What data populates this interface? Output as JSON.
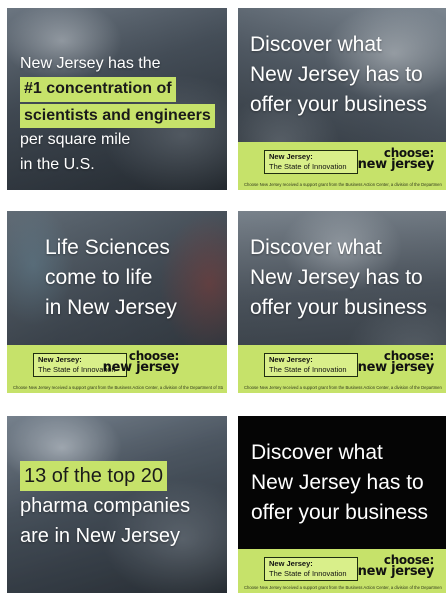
{
  "ads": {
    "a1": {
      "line1": "New Jersey has the",
      "highlight1": "#1 concentration of",
      "highlight2": "scientists and engineers",
      "line4": "per square mile",
      "line5": "in the U.S."
    },
    "a2": {
      "line1": "Discover what",
      "line2": "New Jersey has to",
      "line3": "offer your business"
    },
    "a3": {
      "line1": "Life Sciences",
      "line2": "come to life",
      "line3": "in New Jersey"
    },
    "a4": {
      "line1": "Discover what",
      "line2": "New Jersey has to",
      "line3": "offer your business"
    },
    "a5": {
      "highlight1": "13 of the top 20",
      "line2": "pharma companies",
      "line3": "are in New Jersey"
    },
    "a6": {
      "line1": "Discover what",
      "line2": "New Jersey has to",
      "line3": "offer your business"
    }
  },
  "footer": {
    "tag_line1": "New Jersey:",
    "tag_line2": "The State of Innovation",
    "logo_line1": "choose:",
    "logo_line2": "new jersey",
    "fine_print": "Choose New Jersey received a support grant from the Business Action Center, a division of the Department of State."
  },
  "colors": {
    "accent_green": "#c6e26a",
    "text_white": "#ffffff",
    "text_dark": "#111111"
  }
}
